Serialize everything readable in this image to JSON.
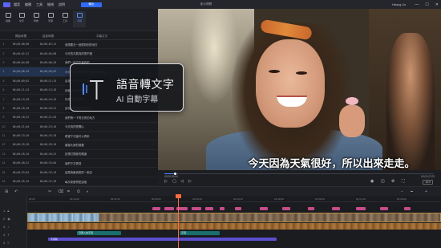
{
  "titlebar": {
    "menu": [
      "檔案",
      "編輯",
      "工具",
      "檢視",
      "說明"
    ],
    "export_label": "輸出",
    "doc_title": "影片標題",
    "user": "Hsiang Lin",
    "controls": [
      "—",
      "☐",
      "✕"
    ]
  },
  "toolbar": {
    "tools": [
      "媒體",
      "文字",
      "特效",
      "字幕",
      "工具",
      "字幕"
    ],
    "active_index": 5,
    "subtools": [
      "⇅",
      "⇆",
      "✎",
      "☰",
      "T"
    ],
    "record_label": "語音轉文字"
  },
  "subtitle_list": {
    "headers": [
      "開始時間",
      "結束時間",
      "字幕文字"
    ],
    "rows": [
      {
        "num": "1",
        "start": "00;00;00;00",
        "end": "00;00;02;12",
        "text": "我想要去一個很特別的地方"
      },
      {
        "num": "2",
        "start": "00;00;02;12",
        "end": "00;00;04;08",
        "text": "今天的天氣真的很不錯"
      },
      {
        "num": "3",
        "start": "00;00;04;08",
        "end": "00;00;06;20",
        "text": "我們一起去吃東西吧"
      },
      {
        "num": "4",
        "start": "00;00;06;20",
        "end": "00;00;09;02",
        "text": "今天因為天氣很好，所以出來走走"
      },
      {
        "num": "5",
        "start": "00;00;09;02",
        "end": "00;00;11;15",
        "text": "這裡有很多好吃的東西"
      },
      {
        "num": "6",
        "start": "00;00;11;15",
        "end": "00;00;13;28",
        "text": "我最喜歡吃甜點了"
      },
      {
        "num": "7",
        "start": "00;00;13;28",
        "end": "00;00;16;10",
        "text": "你想不想試試看"
      },
      {
        "num": "8",
        "start": "00;00;16;10",
        "end": "00;00;18;22",
        "text": "這個味道真的很特別"
      },
      {
        "num": "9",
        "start": "00;00;18;22",
        "end": "00;00;21;04",
        "text": "我們等一下再去別的地方"
      },
      {
        "num": "10",
        "start": "00;00;21;04",
        "end": "00;00;23;16",
        "text": "今天真的很開心"
      },
      {
        "num": "11",
        "start": "00;00;23;16",
        "end": "00;00;25;28",
        "text": "希望下次還可以再來"
      },
      {
        "num": "12",
        "start": "00;00;25;28",
        "end": "00;00;28;10",
        "text": "謝謝大家的觀看"
      },
      {
        "num": "13",
        "start": "00;00;28;10",
        "end": "00;00;30;22",
        "text": "記得訂閱我的頻道"
      },
      {
        "num": "14",
        "start": "00;00;30;22",
        "end": "00;00;33;04",
        "text": "我們下次再見"
      },
      {
        "num": "15",
        "start": "00;00;33;04",
        "end": "00;00;35;16",
        "text": "這是我最喜歡的一家店"
      },
      {
        "num": "16",
        "start": "00;00;35;16",
        "end": "00;00;37;28",
        "text": "每次來都會點這個"
      },
      {
        "num": "17",
        "start": "00;00;37;28",
        "end": "00;00;40;10",
        "text": "你們也一定要試試看"
      }
    ]
  },
  "overlay_card": {
    "title": "語音轉文字",
    "subtitle": "AI 自動字幕"
  },
  "preview": {
    "caption": "今天因為天氣很好，所以出來走走。"
  },
  "player": {
    "current_time": "00;00;03;04",
    "total_time": "00;01;27;03",
    "progress": 0.04,
    "ratio_label": "16:9"
  },
  "timeline": {
    "ruler_marks": [
      "00;00",
      "00;16;20",
      "00;33;10",
      "00;50;00",
      "01;06;20",
      "01;23;10",
      "01;40;00",
      "01;56;20",
      "02;13;10",
      "02;30;00"
    ],
    "track_labels": [
      "1",
      "2",
      "3",
      "4",
      "5"
    ],
    "caption_clip_1": "已匯入的字幕",
    "caption_clip_2": "字幕",
    "caption_clip_3": "字幕軌"
  },
  "colors": {
    "accent": "#2f6bff",
    "playhead": "#ff6b3d",
    "caption_clip": "#1a6f6d",
    "subtitle_clip": "#5b4fd0"
  }
}
